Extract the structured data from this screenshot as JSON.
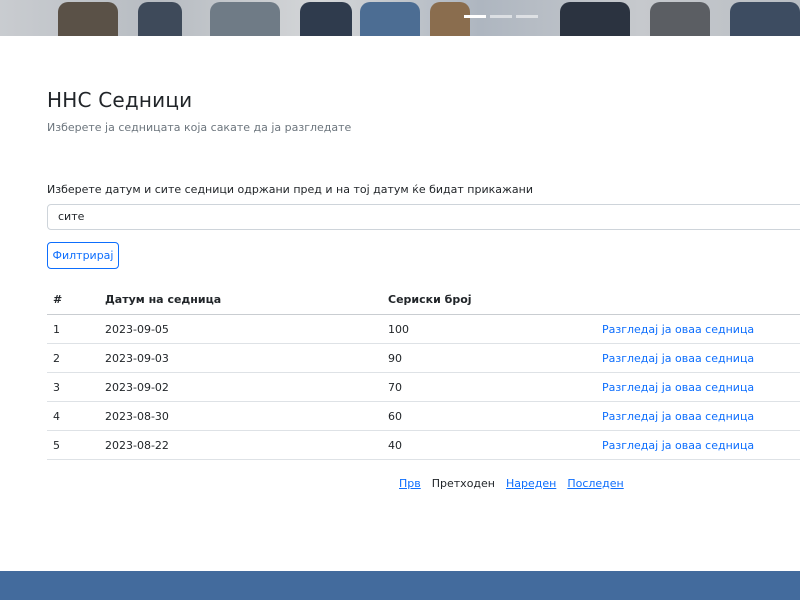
{
  "header": {
    "title": "ННС Седници",
    "subtitle": "Изберете ја седницата која сакате да ја разгледате"
  },
  "filter": {
    "label": "Изберете датум и сите седници одржани пред и на тој датум ќе бидат прикажани",
    "selected": "сите",
    "button_label": "Филтрирај"
  },
  "table": {
    "columns": [
      "#",
      "Датум на седница",
      "Сериски број",
      ""
    ],
    "rows": [
      {
        "num": "1",
        "date": "2023-09-05",
        "serial": "100",
        "link": "Разгледај ја оваа седница"
      },
      {
        "num": "2",
        "date": "2023-09-03",
        "serial": "90",
        "link": "Разгледај ја оваа седница"
      },
      {
        "num": "3",
        "date": "2023-09-02",
        "serial": "70",
        "link": "Разгледај ја оваа седница"
      },
      {
        "num": "4",
        "date": "2023-08-30",
        "serial": "60",
        "link": "Разгледај ја оваа седница"
      },
      {
        "num": "5",
        "date": "2023-08-22",
        "serial": "40",
        "link": "Разгледај ја оваа седница"
      }
    ]
  },
  "pagination": {
    "first": "Прв",
    "previous": "Претходен",
    "next": "Нареден",
    "last": "Последен"
  },
  "colors": {
    "link": "#0d6efd",
    "footer": "#436b9d"
  }
}
